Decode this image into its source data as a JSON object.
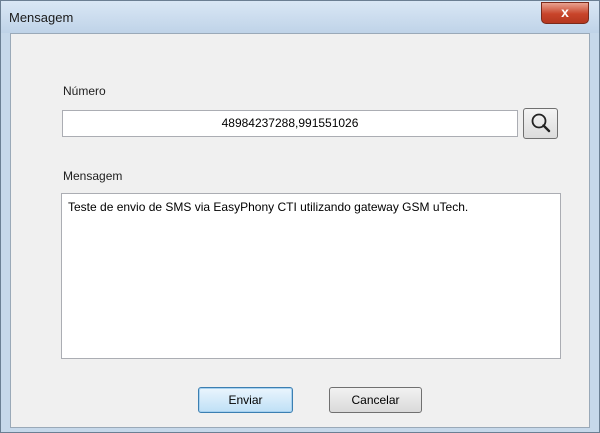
{
  "window": {
    "title": "Mensagem",
    "close_glyph": "x"
  },
  "form": {
    "numero_label": "Número",
    "numero_value": "48984237288,991551026",
    "search_icon": "search-icon",
    "mensagem_label": "Mensagem",
    "mensagem_value": "Teste de envio de SMS via EasyPhony CTI utilizando gateway GSM uTech."
  },
  "buttons": {
    "send_label": "Enviar",
    "cancel_label": "Cancelar"
  }
}
